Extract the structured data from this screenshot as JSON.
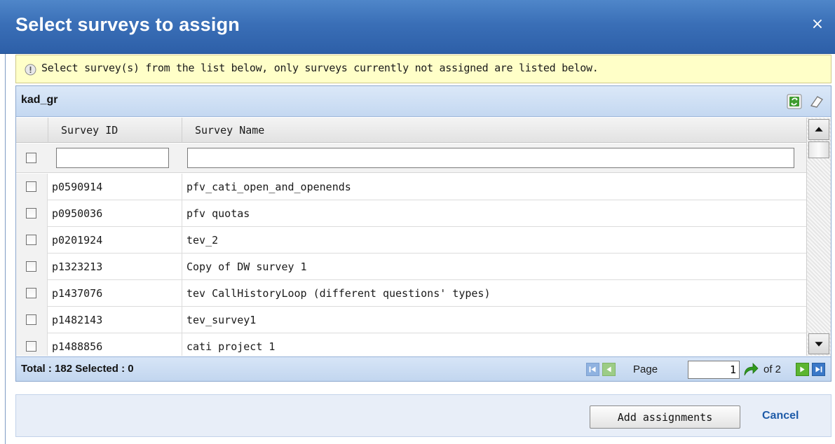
{
  "dialog": {
    "title": "Select surveys to assign",
    "close_symbol": "×"
  },
  "info": {
    "icon": "info-icon",
    "text": "Select survey(s) from the list below, only surveys currently not assigned are listed below."
  },
  "grid": {
    "group_name": "kad_gr",
    "toolbar": [
      {
        "icon": "refresh-icon"
      },
      {
        "icon": "eraser-icon"
      }
    ],
    "columns": [
      "Survey ID",
      "Survey Name"
    ],
    "filters": {
      "survey_id": "",
      "survey_name": ""
    },
    "rows": [
      {
        "id": "p0590914",
        "name": "pfv_cati_open_and_openends"
      },
      {
        "id": "p0950036",
        "name": "pfv quotas"
      },
      {
        "id": "p0201924",
        "name": "tev_2"
      },
      {
        "id": "p1323213",
        "name": "Copy of DW survey 1"
      },
      {
        "id": "p1437076",
        "name": "tev CallHistoryLoop (different questions' types)"
      },
      {
        "id": "p1482143",
        "name": "tev_survey1"
      },
      {
        "id": "p1488856",
        "name": "cati project 1"
      }
    ]
  },
  "footer": {
    "summary": "Total : 182 Selected : 0",
    "page_label": "Page",
    "page_value": "1",
    "of_label": "of 2"
  },
  "actions": {
    "add_label": "Add assignments",
    "cancel_label": "Cancel"
  },
  "colors": {
    "title_bg": "#3a6fb7",
    "info_bg": "#ffffc8",
    "header_bg": "#c4d8f1",
    "link": "#1e5ba8",
    "page_btn_green": "#5cb531",
    "page_btn_blue": "#3a78c8"
  }
}
